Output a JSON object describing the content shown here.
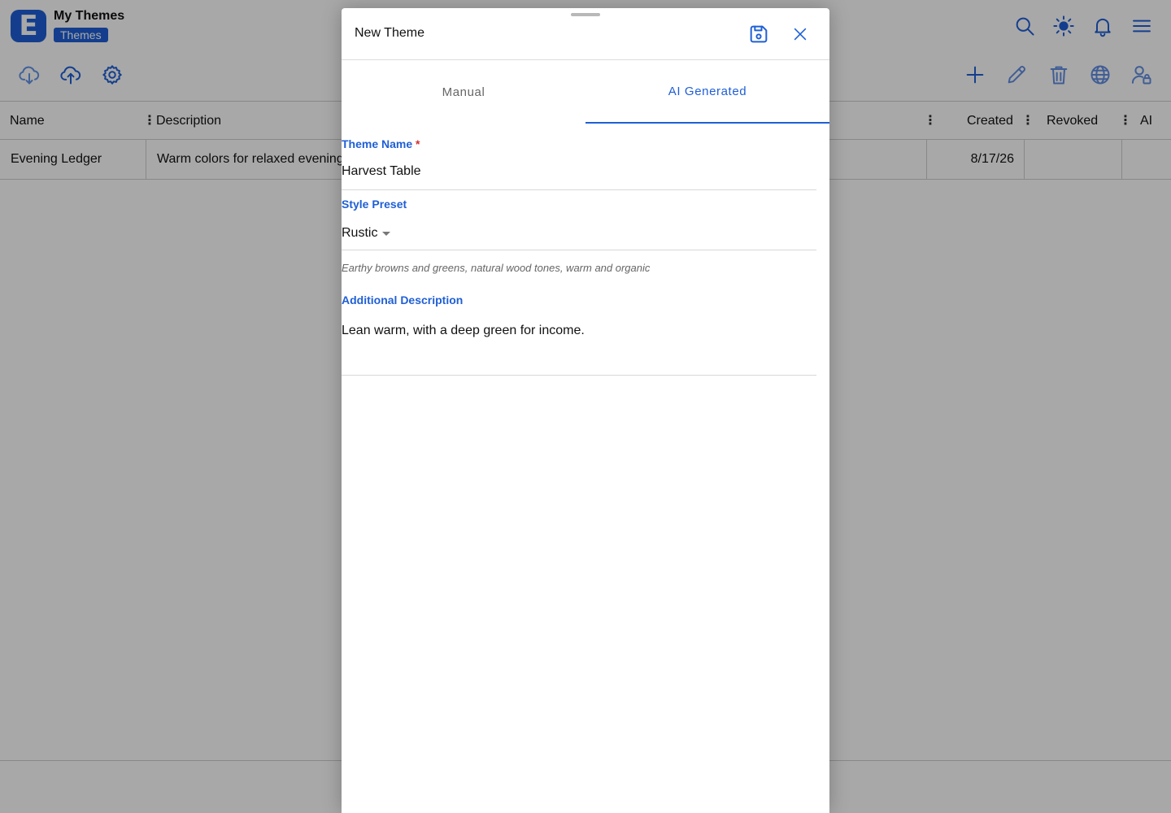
{
  "app": {
    "title": "My Themes",
    "badge": "Themes",
    "logo_letter": "E",
    "accent_color": "#1f5fd6"
  },
  "header_icons": [
    "search-icon",
    "sun-icon",
    "bell-icon",
    "menu-icon"
  ],
  "toolbar_left": [
    "cloud-download-icon",
    "cloud-upload-icon",
    "gear-icon"
  ],
  "toolbar_right": [
    "plus-icon",
    "pencil-icon",
    "trash-icon",
    "globe-icon",
    "user-lock-icon"
  ],
  "table": {
    "columns": {
      "name": "Name",
      "description": "Description",
      "created": "Created",
      "revoked": "Revoked",
      "ai": "AI"
    },
    "rows": [
      {
        "name": "Evening Ledger",
        "description": "Warm colors for relaxed evenings",
        "created": "8/17/26",
        "revoked": "",
        "ai": ""
      }
    ]
  },
  "modal": {
    "title": "New Theme",
    "tabs": [
      "Manual",
      "AI Generated"
    ],
    "active_tab": "AI Generated",
    "theme_name": {
      "label": "Theme Name",
      "required_mark": "*",
      "value": "Harvest Table"
    },
    "style_preset": {
      "label": "Style Preset",
      "value": "Rustic",
      "hint": "Earthy browns and greens, natural wood tones, warm and organic"
    },
    "additional_description": {
      "label": "Additional Description",
      "value": "Lean warm, with a deep green for income."
    }
  }
}
